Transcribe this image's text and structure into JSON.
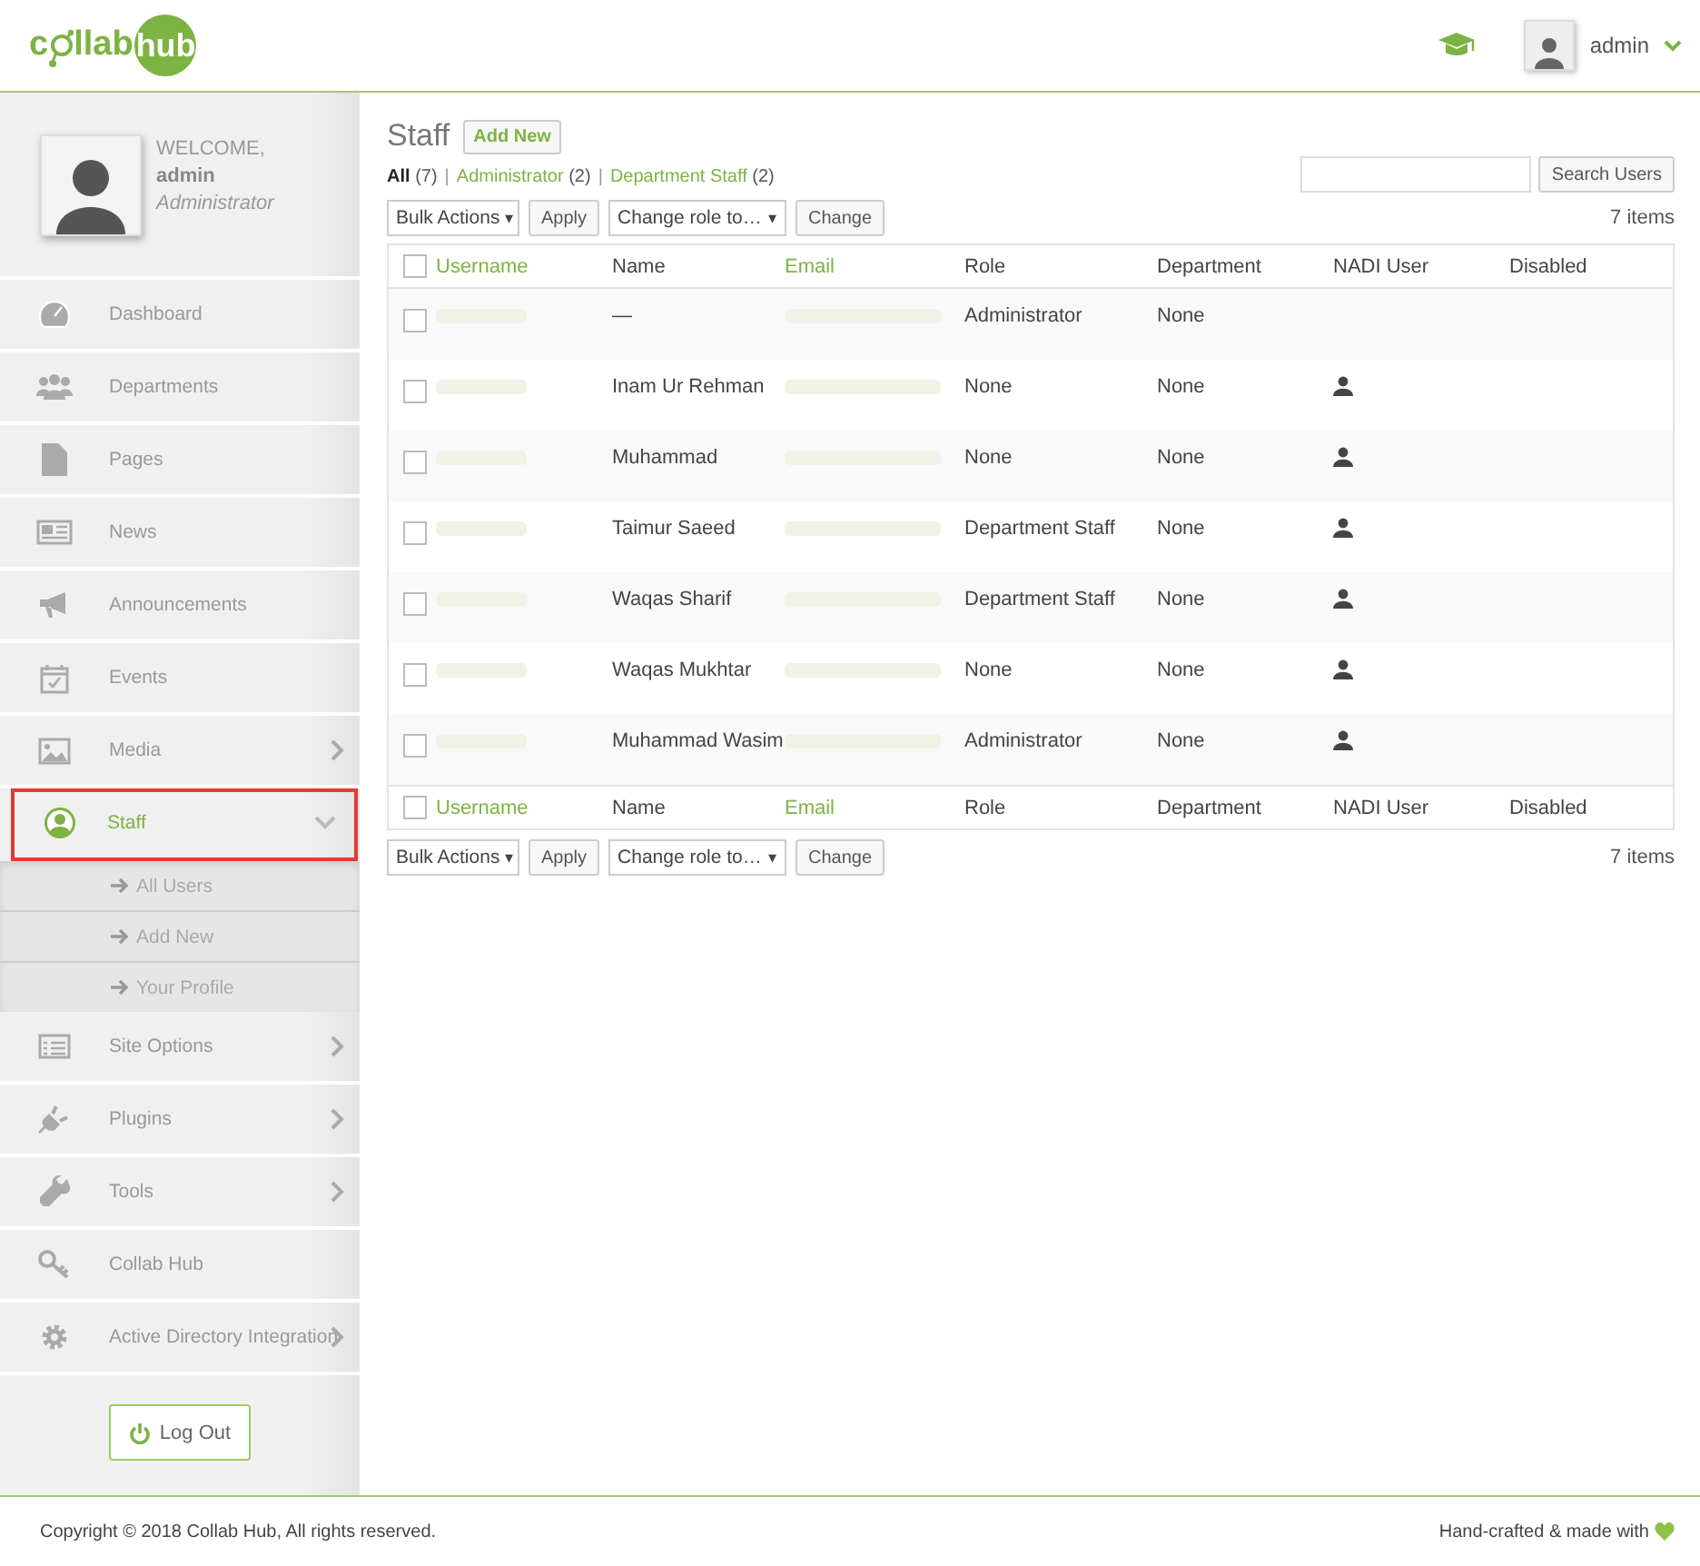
{
  "logo": {
    "first": "c",
    "second": "llab",
    "badge": "hub"
  },
  "header": {
    "user": "admin"
  },
  "profile": {
    "greeting": "WELCOME,",
    "name": "admin",
    "role": "Administrator"
  },
  "sidebar": {
    "items": [
      {
        "label": "Dashboard",
        "selected": false,
        "highlighted": false
      },
      {
        "label": "Departments",
        "selected": false,
        "highlighted": false
      },
      {
        "label": "Pages",
        "selected": false,
        "highlighted": false
      },
      {
        "label": "News",
        "selected": false,
        "highlighted": false
      },
      {
        "label": "Announcements",
        "selected": false,
        "highlighted": false
      },
      {
        "label": "Events",
        "selected": false,
        "highlighted": false
      },
      {
        "label": "Media",
        "expanded": false,
        "selected": false,
        "highlighted": false
      },
      {
        "label": "Staff",
        "expanded": true,
        "selected": true,
        "highlighted": true,
        "children": [
          {
            "label": "All Users"
          },
          {
            "label": "Add New"
          },
          {
            "label": "Your Profile"
          }
        ]
      },
      {
        "label": "Site Options",
        "expanded": false,
        "selected": false,
        "highlighted": false
      },
      {
        "label": "Plugins",
        "expanded": false,
        "selected": false,
        "highlighted": false
      },
      {
        "label": "Tools",
        "expanded": false,
        "selected": false,
        "highlighted": false
      },
      {
        "label": "Collab Hub",
        "selected": false,
        "highlighted": false
      },
      {
        "label": "Active Directory Integration",
        "expanded": false,
        "selected": false,
        "highlighted": false
      }
    ],
    "logout": "Log Out"
  },
  "page": {
    "title": "Staff",
    "add_new": "Add New",
    "filters": [
      {
        "label": "All",
        "count": "(7)",
        "selected": true
      },
      {
        "separator": "|",
        "label": "Administrator",
        "count": "(2)",
        "selected": false
      },
      {
        "separator": "|",
        "label": "Department Staff",
        "count": "(2)",
        "selected": false
      }
    ],
    "search_button": "Search Users"
  },
  "top_nav": {
    "bulk_actions": "Bulk Actions",
    "bulk_arrow": "▾",
    "apply": "Apply",
    "change_role": "Change role to…",
    "role_arrow": "▾",
    "change": "Change",
    "item_count": "7 items"
  },
  "table": {
    "select_all_checked": false,
    "columns": [
      "Username",
      "Name",
      "Email",
      "Role",
      "Department",
      "NADI User",
      "Disabled"
    ],
    "rows": [
      {
        "checked": false,
        "name": "—",
        "role": "Administrator",
        "department": "None",
        "nadi_user": false
      },
      {
        "checked": false,
        "name": "Inam Ur Rehman",
        "role": "None",
        "department": "None",
        "nadi_user": true
      },
      {
        "checked": false,
        "name": "Muhammad",
        "role": "None",
        "department": "None",
        "nadi_user": true
      },
      {
        "checked": false,
        "name": "Taimur Saeed",
        "role": "Department Staff",
        "department": "None",
        "nadi_user": true
      },
      {
        "checked": false,
        "name": "Waqas Sharif",
        "role": "Department Staff",
        "department": "None",
        "nadi_user": true
      },
      {
        "checked": false,
        "name": "Waqas Mukhtar",
        "role": "None",
        "department": "None",
        "nadi_user": true
      },
      {
        "checked": false,
        "name": "Muhammad Wasim",
        "role": "Administrator",
        "department": "None",
        "nadi_user": true
      }
    ],
    "footer_select_all_checked": false,
    "footer_columns": [
      "Username",
      "Name",
      "Email",
      "Role",
      "Department",
      "NADI User",
      "Disabled"
    ]
  },
  "bottom_nav": {
    "bulk_actions": "Bulk Actions",
    "bulk_arrow": "▾",
    "apply": "Apply",
    "change_role": "Change role to…",
    "role_arrow": "▾",
    "change": "Change",
    "item_count": "7 items"
  },
  "footer": {
    "copyright": "Copyright © 2018 Collab Hub, All rights reserved.",
    "credit": "Hand-crafted & made with"
  }
}
